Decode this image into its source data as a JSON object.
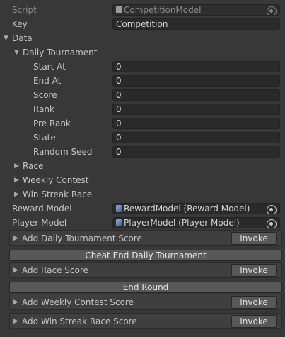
{
  "script": {
    "label": "Script",
    "value": "CompetitionModel"
  },
  "key": {
    "label": "Key",
    "value": "Competition"
  },
  "data": {
    "label": "Data",
    "daily_tournament": {
      "label": "Daily Tournament",
      "fields": [
        {
          "label": "Start At",
          "value": "0"
        },
        {
          "label": "End At",
          "value": "0"
        },
        {
          "label": "Score",
          "value": "0"
        },
        {
          "label": "Rank",
          "value": "0"
        },
        {
          "label": "Pre Rank",
          "value": "0"
        },
        {
          "label": "State",
          "value": "0"
        },
        {
          "label": "Random Seed",
          "value": "0"
        }
      ]
    },
    "race": {
      "label": "Race"
    },
    "weekly_contest": {
      "label": "Weekly Contest"
    },
    "win_streak_race": {
      "label": "Win Streak Race"
    }
  },
  "reward_model": {
    "label": "Reward Model",
    "value": "RewardModel (Reward Model)"
  },
  "player_model": {
    "label": "Player Model",
    "value": "PlayerModel (Player Model)"
  },
  "actions": {
    "add_daily": {
      "label": "Add Daily Tournament Score",
      "button": "Invoke"
    },
    "cheat_end": {
      "label": "Cheat End Daily Tournament"
    },
    "add_race": {
      "label": "Add Race Score",
      "button": "Invoke"
    },
    "end_round": {
      "label": "End Round"
    },
    "add_weekly": {
      "label": "Add Weekly Contest Score",
      "button": "Invoke"
    },
    "add_win_streak": {
      "label": "Add Win Streak Race Score",
      "button": "Invoke"
    }
  },
  "colors": {
    "background": "#383838",
    "field": "#2a2a2a",
    "button": "#585858",
    "text": "#c4c4c4"
  }
}
